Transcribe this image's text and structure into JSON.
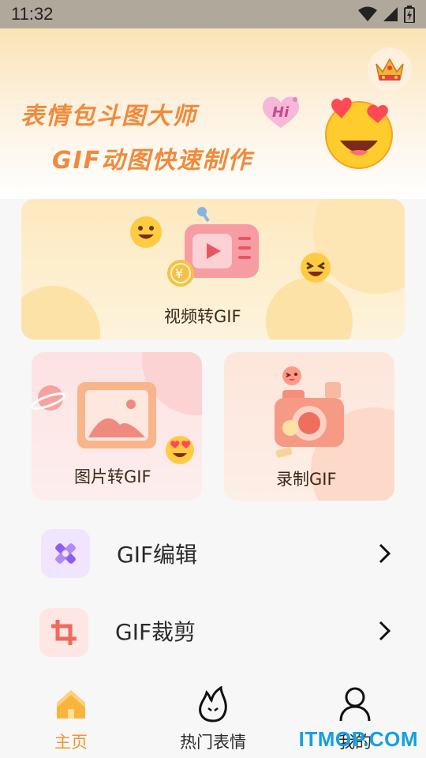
{
  "status_bar": {
    "time": "11:32"
  },
  "banner": {
    "line1": "表情包斗图大师",
    "line2": "GIF动图快速制作",
    "hi_text": "Hi"
  },
  "cards": {
    "video": {
      "label": "视频转GIF"
    },
    "image": {
      "label": "图片转GIF"
    },
    "record": {
      "label": "录制GIF"
    }
  },
  "list": [
    {
      "label": "GIF编辑",
      "icon": "puzzle-edit-icon",
      "accent": "#8d5cf0"
    },
    {
      "label": "GIF裁剪",
      "icon": "crop-icon",
      "accent": "#f06a5a"
    }
  ],
  "tabbar": {
    "tabs": [
      {
        "label": "主页",
        "icon": "home-icon",
        "active": true
      },
      {
        "label": "热门表情",
        "icon": "fire-icon",
        "active": false
      },
      {
        "label": "我的",
        "icon": "user-icon",
        "active": false
      }
    ]
  },
  "watermark": "ITMOP.COM",
  "colors": {
    "accent_orange": "#f0962e",
    "banner_text": "#f08a3c",
    "watermark": "#14a0e0"
  }
}
